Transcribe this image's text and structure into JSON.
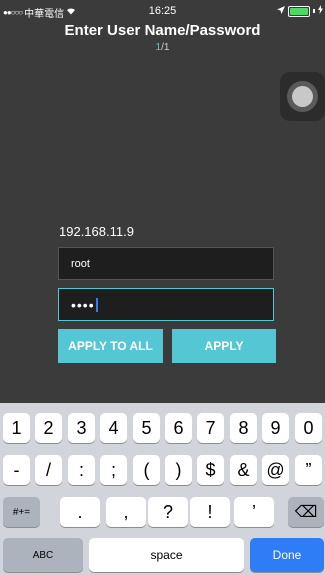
{
  "status": {
    "carrier": "中華電信",
    "time": "16:25"
  },
  "header": {
    "title": "Enter User Name/Password",
    "page_current": "1",
    "page_total": "/1"
  },
  "device": {
    "ip": "192.168.11.9"
  },
  "form": {
    "username": "root",
    "password_mask": "••••"
  },
  "buttons": {
    "apply_all": "APPLY TO ALL",
    "apply": "APPLY"
  },
  "keyboard": {
    "row1": [
      "1",
      "2",
      "3",
      "4",
      "5",
      "6",
      "7",
      "8",
      "9",
      "0"
    ],
    "row2": [
      "-",
      "/",
      ":",
      ";",
      "(",
      ")",
      "$",
      "&",
      "@",
      "”"
    ],
    "row3": [
      ".",
      ",",
      "?",
      "!",
      "’"
    ],
    "mode_symbols": "#+=",
    "backspace": "⌫",
    "abc": "ABC",
    "space": "space",
    "done": "Done"
  }
}
